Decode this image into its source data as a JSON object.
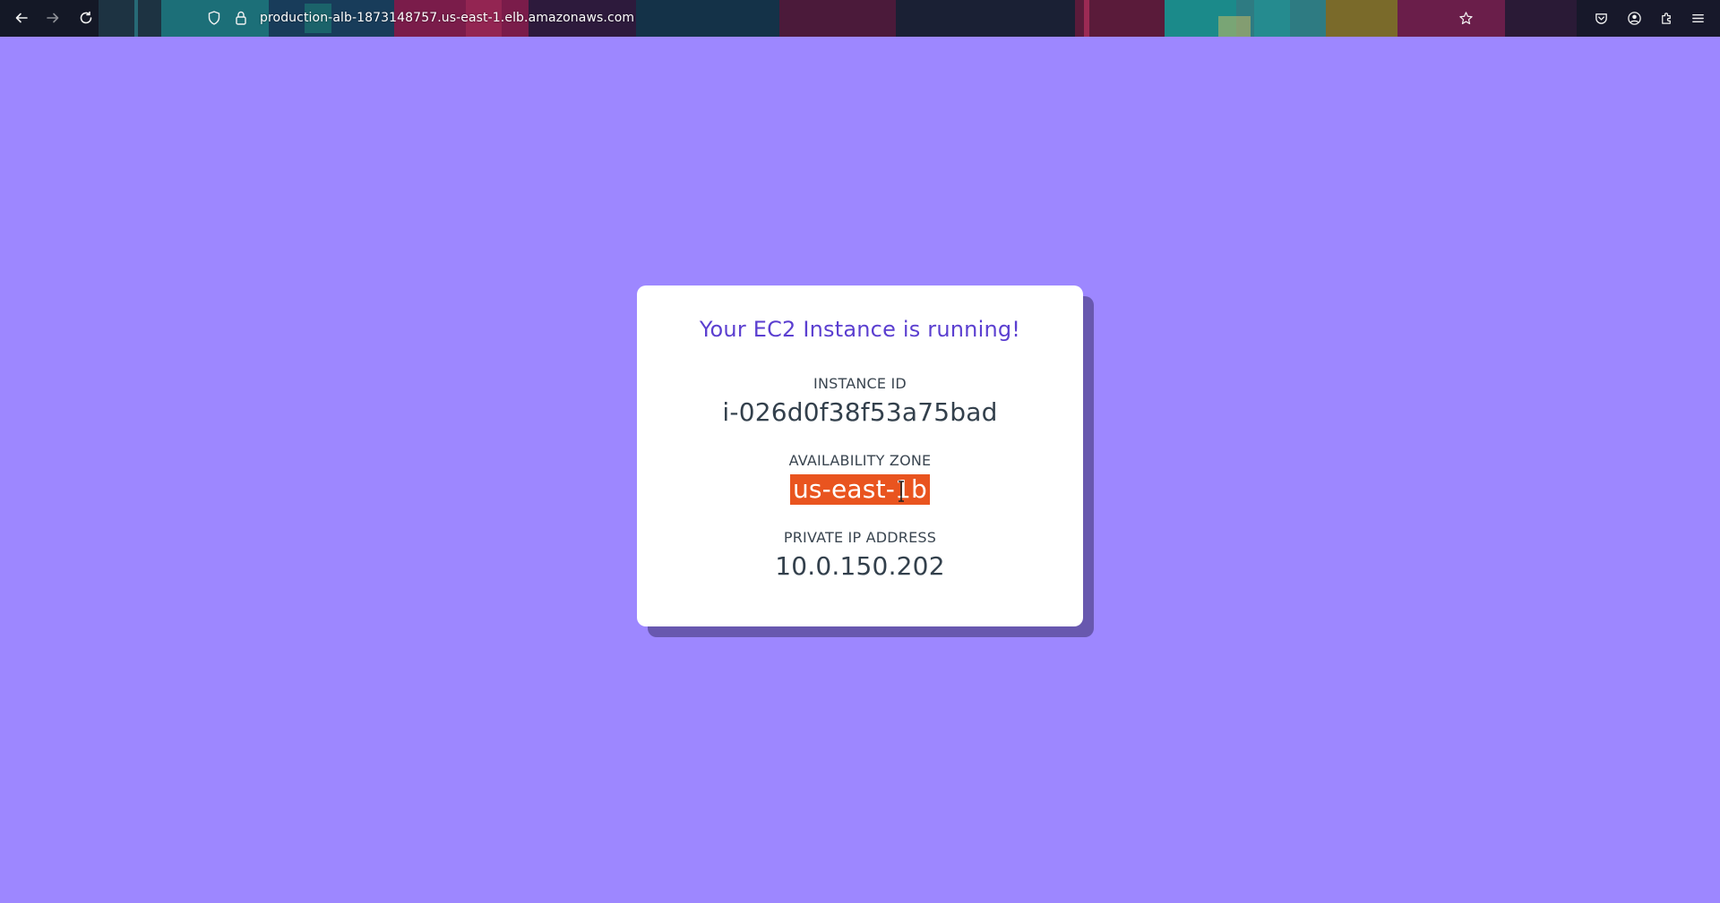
{
  "browser": {
    "url": "production-alb-1873148757.us-east-1.elb.amazonaws.com",
    "icons": {
      "back": "back-arrow-icon",
      "forward": "forward-arrow-icon",
      "reload": "reload-icon",
      "tracking": "shield-icon",
      "security": "lock-icon",
      "bookmark": "star-icon",
      "pocket": "pocket-icon",
      "account": "account-icon",
      "extensions": "puzzle-icon",
      "menu": "hamburger-menu-icon"
    }
  },
  "page": {
    "background_color": "#9d87ff",
    "title": "Your EC2 Instance is running!",
    "title_color": "#5b3fd0",
    "instance_id_label": "INSTANCE ID",
    "instance_id": "i-026d0f38f53a75bad",
    "az_label": "AVAILABILITY ZONE",
    "availability_zone": "us-east-1b",
    "az_selection_color": "#e9541f",
    "ip_label": "PRIVATE IP ADDRESS",
    "private_ip": "10.0.150.202"
  }
}
